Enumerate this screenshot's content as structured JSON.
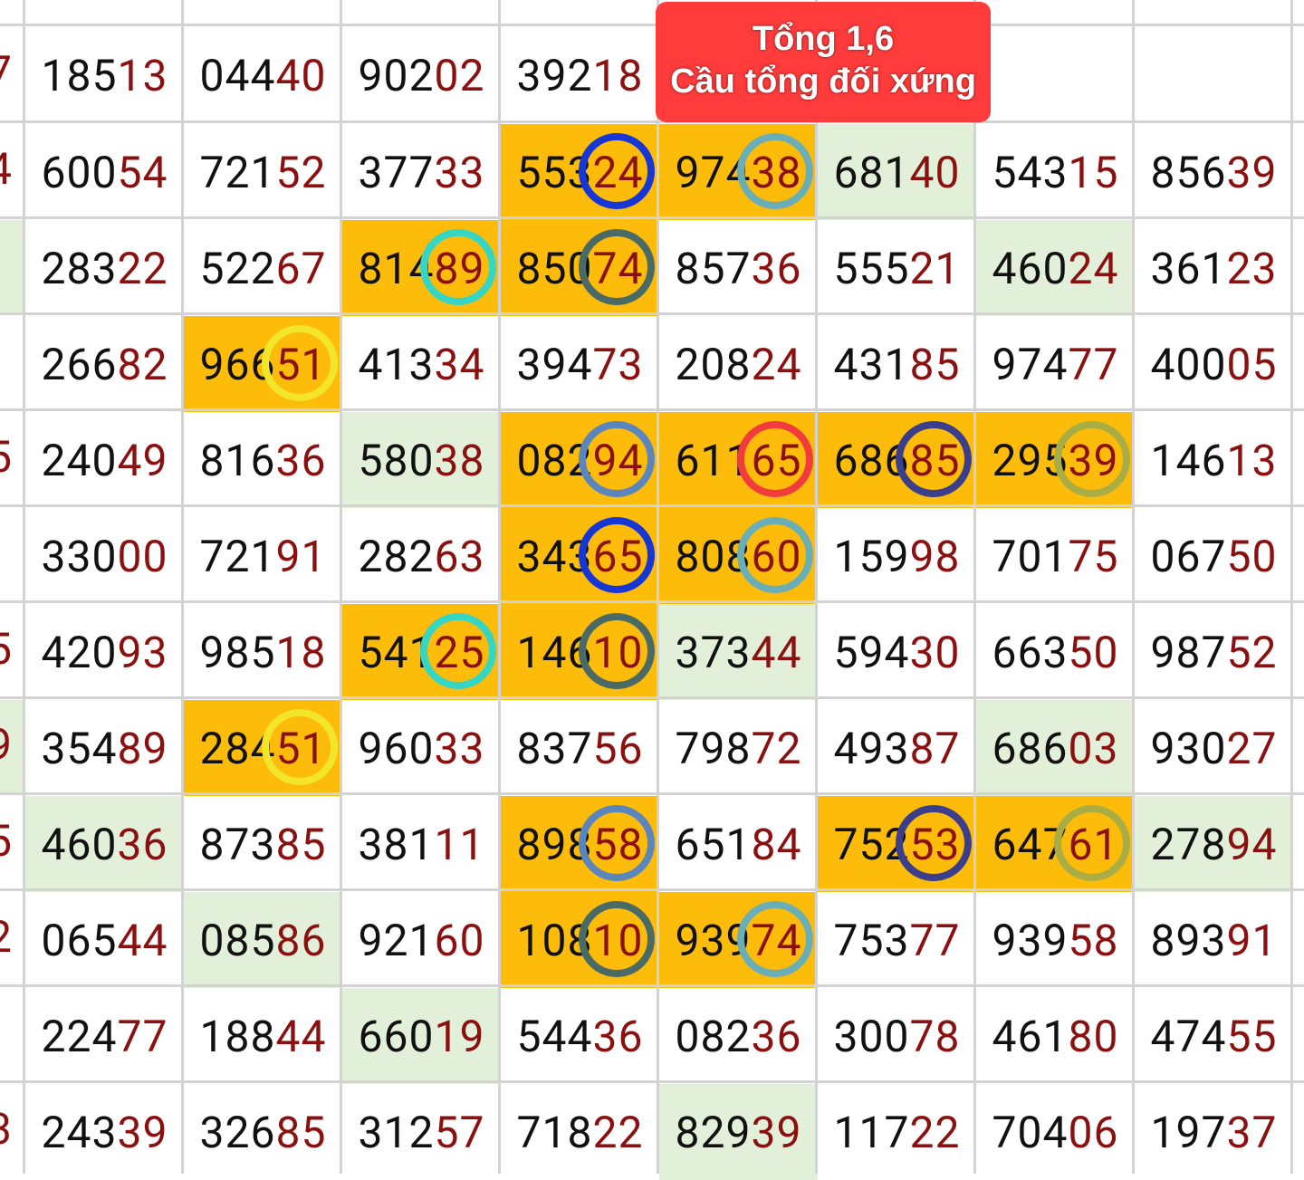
{
  "banner": {
    "line1": "Tổng 1,6",
    "line2": "Cầu tổng đối xứng"
  },
  "left_edge_digits": [
    "7",
    "4",
    "",
    "",
    "5",
    "",
    "5",
    "9",
    "5",
    "2",
    "",
    "3"
  ],
  "left_edge_fills": [
    "none",
    "none",
    "green",
    "none",
    "none",
    "none",
    "none",
    "green",
    "none",
    "none",
    "none",
    "none"
  ],
  "rows": [
    [
      {
        "head": "185",
        "tail": "13",
        "fill": "none"
      },
      {
        "head": "044",
        "tail": "40",
        "fill": "none"
      },
      {
        "head": "902",
        "tail": "02",
        "fill": "none"
      },
      {
        "head": "392",
        "tail": "18",
        "fill": "none"
      },
      {
        "head": "",
        "tail": "",
        "fill": "none"
      },
      {
        "head": "",
        "tail": "",
        "fill": "none"
      },
      {
        "head": "",
        "tail": "",
        "fill": "none"
      },
      {
        "head": "",
        "tail": "",
        "fill": "none"
      }
    ],
    [
      {
        "head": "600",
        "tail": "54",
        "fill": "none"
      },
      {
        "head": "721",
        "tail": "52",
        "fill": "none"
      },
      {
        "head": "377",
        "tail": "33",
        "fill": "none"
      },
      {
        "head": "553",
        "tail": "24",
        "fill": "orange",
        "ring": "#1636d6"
      },
      {
        "head": "974",
        "tail": "38",
        "fill": "orange",
        "ring": "#6aaeb8"
      },
      {
        "head": "681",
        "tail": "40",
        "fill": "green"
      },
      {
        "head": "543",
        "tail": "15",
        "fill": "none"
      },
      {
        "head": "856",
        "tail": "39",
        "fill": "none"
      }
    ],
    [
      {
        "head": "283",
        "tail": "22",
        "fill": "none"
      },
      {
        "head": "522",
        "tail": "67",
        "fill": "none"
      },
      {
        "head": "814",
        "tail": "89",
        "fill": "orange",
        "ring": "#36d6c4"
      },
      {
        "head": "850",
        "tail": "74",
        "fill": "orange",
        "ring": "#4a6a66"
      },
      {
        "head": "857",
        "tail": "36",
        "fill": "none"
      },
      {
        "head": "555",
        "tail": "21",
        "fill": "none"
      },
      {
        "head": "460",
        "tail": "24",
        "fill": "green"
      },
      {
        "head": "361",
        "tail": "23",
        "fill": "none"
      }
    ],
    [
      {
        "head": "266",
        "tail": "82",
        "fill": "none"
      },
      {
        "head": "966",
        "tail": "51",
        "fill": "orange",
        "ring": "#f3e62a"
      },
      {
        "head": "413",
        "tail": "34",
        "fill": "none"
      },
      {
        "head": "394",
        "tail": "73",
        "fill": "none"
      },
      {
        "head": "208",
        "tail": "24",
        "fill": "none"
      },
      {
        "head": "431",
        "tail": "85",
        "fill": "none"
      },
      {
        "head": "974",
        "tail": "77",
        "fill": "none"
      },
      {
        "head": "400",
        "tail": "05",
        "fill": "none"
      }
    ],
    [
      {
        "head": "240",
        "tail": "49",
        "fill": "none"
      },
      {
        "head": "816",
        "tail": "36",
        "fill": "none"
      },
      {
        "head": "580",
        "tail": "38",
        "fill": "green"
      },
      {
        "head": "082",
        "tail": "94",
        "fill": "orange",
        "ring": "#5a86bd"
      },
      {
        "head": "611",
        "tail": "65",
        "fill": "orange",
        "ring": "#f23c3c"
      },
      {
        "head": "686",
        "tail": "85",
        "fill": "orange",
        "ring": "#3b3e8a"
      },
      {
        "head": "295",
        "tail": "39",
        "fill": "orange",
        "ring": "#a9ad44"
      },
      {
        "head": "146",
        "tail": "13",
        "fill": "none"
      }
    ],
    [
      {
        "head": "330",
        "tail": "00",
        "fill": "none"
      },
      {
        "head": "721",
        "tail": "91",
        "fill": "none"
      },
      {
        "head": "282",
        "tail": "63",
        "fill": "none"
      },
      {
        "head": "343",
        "tail": "65",
        "fill": "orange",
        "ring": "#1636d6"
      },
      {
        "head": "808",
        "tail": "60",
        "fill": "orange",
        "ring": "#6aaeb8"
      },
      {
        "head": "159",
        "tail": "98",
        "fill": "none"
      },
      {
        "head": "701",
        "tail": "75",
        "fill": "none"
      },
      {
        "head": "067",
        "tail": "50",
        "fill": "none"
      }
    ],
    [
      {
        "head": "420",
        "tail": "93",
        "fill": "none"
      },
      {
        "head": "985",
        "tail": "18",
        "fill": "none"
      },
      {
        "head": "541",
        "tail": "25",
        "fill": "orange",
        "ring": "#36d6c4"
      },
      {
        "head": "146",
        "tail": "10",
        "fill": "orange",
        "ring": "#4a6a66"
      },
      {
        "head": "373",
        "tail": "44",
        "fill": "green"
      },
      {
        "head": "594",
        "tail": "30",
        "fill": "none"
      },
      {
        "head": "663",
        "tail": "50",
        "fill": "none"
      },
      {
        "head": "987",
        "tail": "52",
        "fill": "none"
      }
    ],
    [
      {
        "head": "354",
        "tail": "89",
        "fill": "none"
      },
      {
        "head": "284",
        "tail": "51",
        "fill": "orange",
        "ring": "#f3e62a"
      },
      {
        "head": "960",
        "tail": "33",
        "fill": "none"
      },
      {
        "head": "837",
        "tail": "56",
        "fill": "none"
      },
      {
        "head": "798",
        "tail": "72",
        "fill": "none"
      },
      {
        "head": "493",
        "tail": "87",
        "fill": "none"
      },
      {
        "head": "686",
        "tail": "03",
        "fill": "green"
      },
      {
        "head": "930",
        "tail": "27",
        "fill": "none"
      }
    ],
    [
      {
        "head": "460",
        "tail": "36",
        "fill": "green"
      },
      {
        "head": "873",
        "tail": "85",
        "fill": "none"
      },
      {
        "head": "381",
        "tail": "11",
        "fill": "none"
      },
      {
        "head": "898",
        "tail": "58",
        "fill": "orange",
        "ring": "#5a86bd"
      },
      {
        "head": "651",
        "tail": "84",
        "fill": "none"
      },
      {
        "head": "752",
        "tail": "53",
        "fill": "orange",
        "ring": "#3b3e8a"
      },
      {
        "head": "647",
        "tail": "61",
        "fill": "orange",
        "ring": "#a9ad44"
      },
      {
        "head": "278",
        "tail": "94",
        "fill": "green"
      }
    ],
    [
      {
        "head": "065",
        "tail": "44",
        "fill": "none"
      },
      {
        "head": "085",
        "tail": "86",
        "fill": "green"
      },
      {
        "head": "921",
        "tail": "60",
        "fill": "none"
      },
      {
        "head": "108",
        "tail": "10",
        "fill": "orange",
        "ring": "#4a6a66"
      },
      {
        "head": "939",
        "tail": "74",
        "fill": "orange",
        "ring": "#6aaeb8"
      },
      {
        "head": "753",
        "tail": "77",
        "fill": "none"
      },
      {
        "head": "939",
        "tail": "58",
        "fill": "none"
      },
      {
        "head": "893",
        "tail": "91",
        "fill": "none"
      }
    ],
    [
      {
        "head": "224",
        "tail": "77",
        "fill": "none"
      },
      {
        "head": "188",
        "tail": "44",
        "fill": "none"
      },
      {
        "head": "660",
        "tail": "19",
        "fill": "green"
      },
      {
        "head": "544",
        "tail": "36",
        "fill": "none"
      },
      {
        "head": "082",
        "tail": "36",
        "fill": "none"
      },
      {
        "head": "300",
        "tail": "78",
        "fill": "none"
      },
      {
        "head": "461",
        "tail": "80",
        "fill": "none"
      },
      {
        "head": "474",
        "tail": "55",
        "fill": "none"
      }
    ],
    [
      {
        "head": "243",
        "tail": "39",
        "fill": "none"
      },
      {
        "head": "326",
        "tail": "85",
        "fill": "none"
      },
      {
        "head": "312",
        "tail": "57",
        "fill": "none"
      },
      {
        "head": "718",
        "tail": "22",
        "fill": "none"
      },
      {
        "head": "829",
        "tail": "39",
        "fill": "green"
      },
      {
        "head": "117",
        "tail": "22",
        "fill": "none"
      },
      {
        "head": "704",
        "tail": "06",
        "fill": "none"
      },
      {
        "head": "197",
        "tail": "37",
        "fill": "none"
      }
    ]
  ]
}
